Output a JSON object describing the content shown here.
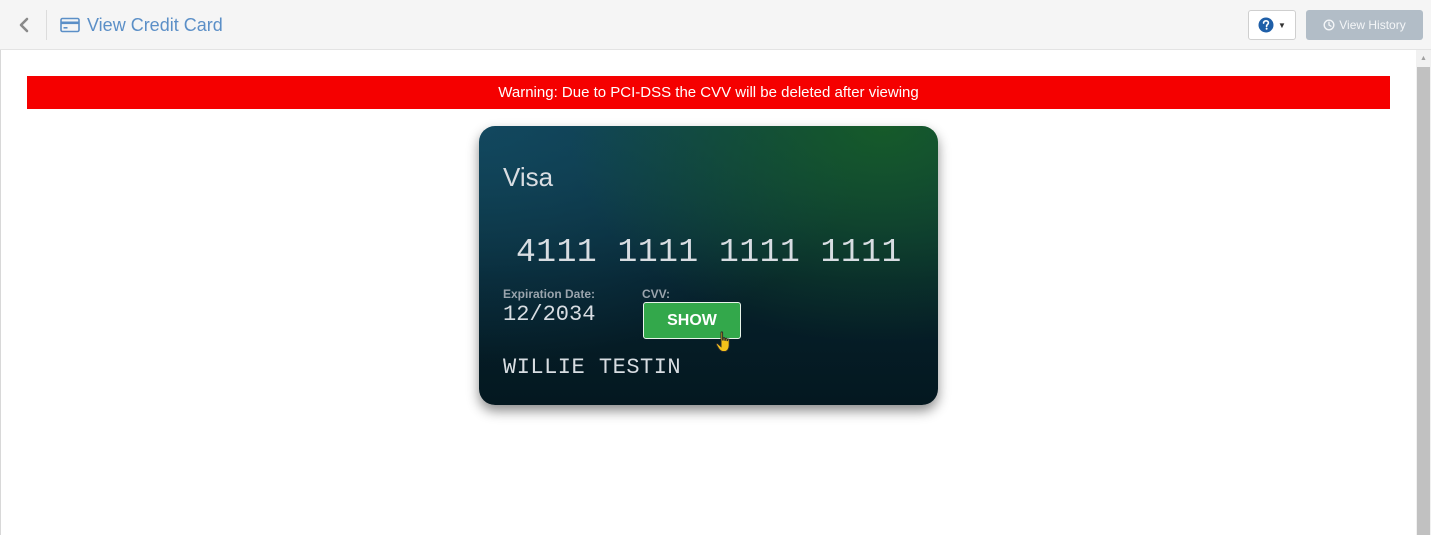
{
  "header": {
    "title": "View Credit Card",
    "history_label": "View History",
    "icons": {
      "back": "chevron-left-icon",
      "title": "credit-card-icon",
      "help": "question-circle-icon",
      "history": "clock-icon"
    }
  },
  "warning": {
    "text": "Warning: Due to PCI-DSS the CVV will be deleted after viewing",
    "color": "#f50000"
  },
  "card": {
    "brand": "Visa",
    "number": "4111 1111 1111 1111",
    "expiration_label": "Expiration Date:",
    "expiration_value": "12/2034",
    "cvv_label": "CVV:",
    "show_label": "SHOW",
    "holder": "WILLIE TESTIN"
  },
  "colors": {
    "accent": "#5b8fc7",
    "show_button": "#33a84b",
    "history_button": "#b2bdc7"
  }
}
